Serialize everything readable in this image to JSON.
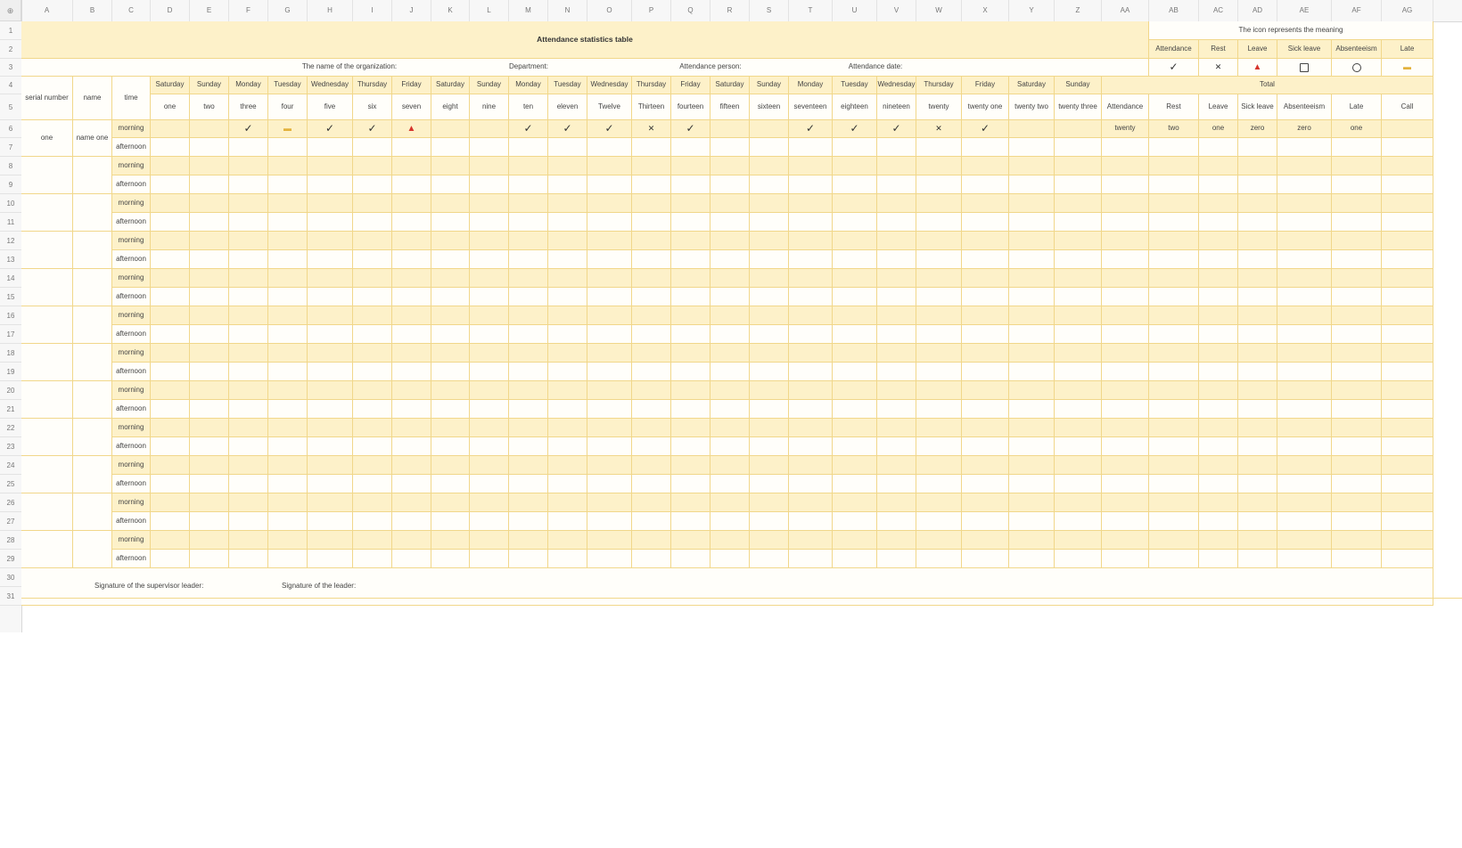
{
  "corner_label": "⊕",
  "columns": [
    "A",
    "B",
    "C",
    "D",
    "E",
    "F",
    "G",
    "H",
    "I",
    "J",
    "K",
    "L",
    "M",
    "N",
    "O",
    "P",
    "Q",
    "R",
    "S",
    "T",
    "U",
    "V",
    "W",
    "X",
    "Y",
    "Z",
    "AA",
    "AB",
    "AC",
    "AD",
    "AE",
    "AF",
    "AG"
  ],
  "rows": [
    "1",
    "2",
    "3",
    "4",
    "5",
    "6",
    "7",
    "8",
    "9",
    "10",
    "11",
    "12",
    "13",
    "14",
    "15",
    "16",
    "17",
    "18",
    "19",
    "20",
    "21",
    "22",
    "23",
    "24",
    "25",
    "26",
    "27",
    "28",
    "29",
    "30",
    "31"
  ],
  "title": "Attendance statistics table",
  "legend": {
    "heading": "The icon represents the meaning",
    "labels": [
      "Attendance",
      "Rest",
      "Leave",
      "Sick leave",
      "Absenteeism",
      "Late"
    ],
    "icons": [
      "check-icon",
      "cross-icon",
      "triangle-icon",
      "square-icon",
      "circle-icon",
      "late-icon"
    ]
  },
  "info": {
    "organization": "The name of the organization:",
    "department": "Department:",
    "person": "Attendance person:",
    "date": "Attendance date:"
  },
  "headers": {
    "serial": "serial number",
    "name": "name",
    "time": "time",
    "total": "Total",
    "weekdays": [
      "Saturday",
      "Sunday",
      "Monday",
      "Tuesday",
      "Wednesday",
      "Thursday",
      "Friday",
      "Saturday",
      "Sunday",
      "Monday",
      "Tuesday",
      "Wednesday",
      "Thursday",
      "Friday",
      "Saturday",
      "Sunday",
      "Monday",
      "Tuesday",
      "Wednesday",
      "Thursday",
      "Friday",
      "Saturday",
      "Sunday"
    ],
    "days": [
      "one",
      "two",
      "three",
      "four",
      "five",
      "six",
      "seven",
      "eight",
      "nine",
      "ten",
      "eleven",
      "Twelve",
      "Thirteen",
      "fourteen",
      "fifteen",
      "sixteen",
      "seventeen",
      "eighteen",
      "nineteen",
      "twenty",
      "twenty one",
      "twenty two",
      "twenty three"
    ],
    "totals": [
      "Attendance",
      "Rest",
      "Leave",
      "Sick leave",
      "Absenteeism",
      "Late",
      "Call"
    ]
  },
  "employee": {
    "serial": "one",
    "name": "name one",
    "morning_marks": [
      "",
      "",
      "check",
      "late",
      "check",
      "check",
      "leave",
      "",
      "",
      "check",
      "check",
      "check",
      "cross",
      "check",
      "",
      "",
      "check",
      "check",
      "check",
      "cross",
      "check",
      "",
      ""
    ],
    "totals": [
      "twenty",
      "two",
      "one",
      "zero",
      "zero",
      "one",
      ""
    ]
  },
  "periods": [
    "morning",
    "afternoon"
  ],
  "footer": {
    "supervisor": "Signature of the supervisor leader:",
    "leader": "Signature of the leader:"
  },
  "colors": {
    "fill": "#fdf1c9",
    "grid": "#f1d78a",
    "leave_red": "#d6342c",
    "late_amber": "#e3b23c"
  }
}
